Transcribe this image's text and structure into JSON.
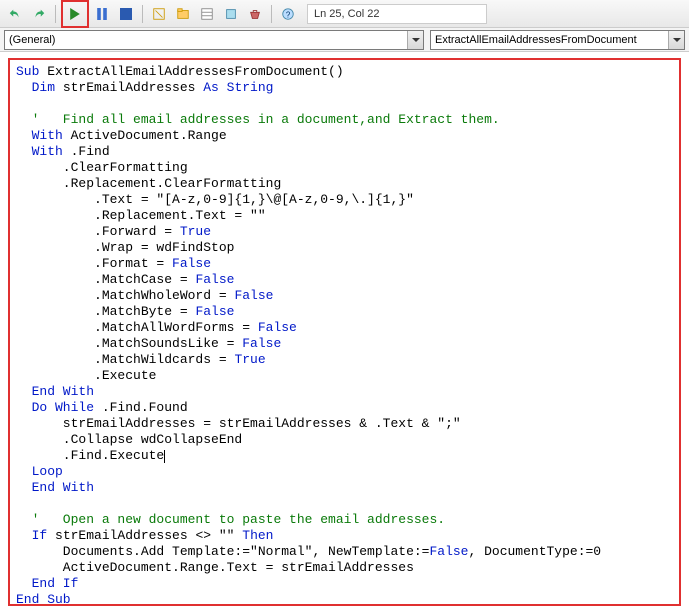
{
  "toolbar": {
    "cursor_position": "Ln 25, Col 22",
    "icons": {
      "undo": "undo-icon",
      "redo": "redo-icon",
      "run": "run-icon",
      "pause": "pause-icon",
      "stop": "stop-icon",
      "design": "design-icon",
      "project": "project-icon",
      "properties": "properties-icon",
      "object": "object-icon",
      "toolbox": "toolbox-icon",
      "help": "help-icon"
    }
  },
  "dropdowns": {
    "left": "(General)",
    "right": "ExtractAllEmailAddressesFromDocument"
  },
  "code": {
    "l1a": "Sub",
    "l1b": " ExtractAllEmailAddressesFromDocument()",
    "l2a": "  Dim",
    "l2b": " strEmailAddresses ",
    "l2c": "As String",
    "l3": "",
    "l4": "  '   Find all email addresses in a document,and Extract them.",
    "l5a": "  With",
    "l5b": " ActiveDocument.Range",
    "l6a": "  With",
    "l6b": " .Find",
    "l7": "      .ClearFormatting",
    "l8": "      .Replacement.ClearFormatting",
    "l9": "          .Text = \"[A-z,0-9]{1,}\\@[A-z,0-9,\\.]{1,}\"",
    "l10": "          .Replacement.Text = \"\"",
    "l11a": "          .Forward = ",
    "l11b": "True",
    "l12": "          .Wrap = wdFindStop",
    "l13a": "          .Format = ",
    "l13b": "False",
    "l14a": "          .MatchCase = ",
    "l14b": "False",
    "l15a": "          .MatchWholeWord = ",
    "l15b": "False",
    "l16a": "          .MatchByte = ",
    "l16b": "False",
    "l17a": "          .MatchAllWordForms = ",
    "l17b": "False",
    "l18a": "          .MatchSoundsLike = ",
    "l18b": "False",
    "l19a": "          .MatchWildcards = ",
    "l19b": "True",
    "l20": "          .Execute",
    "l21": "  End With",
    "l22a": "  Do While",
    "l22b": " .Find.Found",
    "l23": "      strEmailAddresses = strEmailAddresses & .Text & \";\"",
    "l24": "      .Collapse wdCollapseEnd",
    "l25": "      .Find.Execute",
    "l26": "  Loop",
    "l27": "  End With",
    "l28": "",
    "l29": "  '   Open a new document to paste the email addresses.",
    "l30a": "  If",
    "l30b": " strEmailAddresses <> \"\" ",
    "l30c": "Then",
    "l31a": "      Documents.Add Template:=\"Normal\", NewTemplate:=",
    "l31b": "False",
    "l31c": ", DocumentType:=0",
    "l32": "      ActiveDocument.Range.Text = strEmailAddresses",
    "l33": "  End If",
    "l34": "End Sub"
  }
}
